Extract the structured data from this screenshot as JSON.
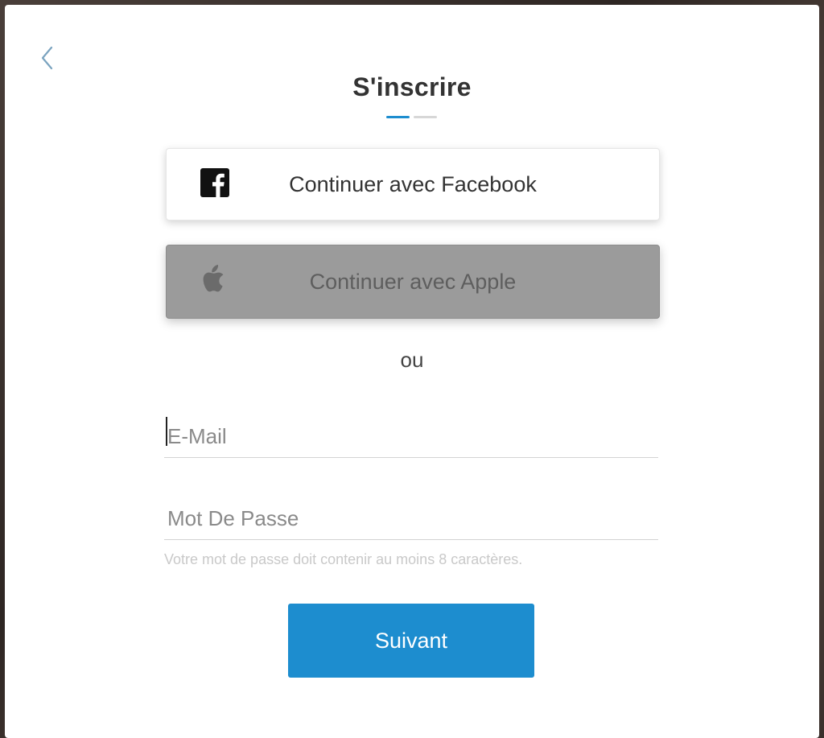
{
  "signup": {
    "title": "S'inscrire",
    "steps": {
      "total": 2,
      "current": 1
    },
    "facebook_button": {
      "label": "Continuer avec Facebook",
      "icon": "facebook-icon"
    },
    "apple_button": {
      "label": "Continuer avec Apple",
      "icon": "apple-icon"
    },
    "separator": "ou",
    "email": {
      "placeholder": "E-Mail",
      "value": ""
    },
    "password": {
      "placeholder": "Mot De Passe",
      "value": ""
    },
    "password_hint": "Votre mot de passe doit contenir au moins 8 caractères.",
    "submit_label": "Suivant"
  },
  "colors": {
    "accent": "#1d8dcf",
    "apple_button_bg": "#9b9b9b",
    "text": "#333333",
    "hint": "#c9c9c9"
  }
}
